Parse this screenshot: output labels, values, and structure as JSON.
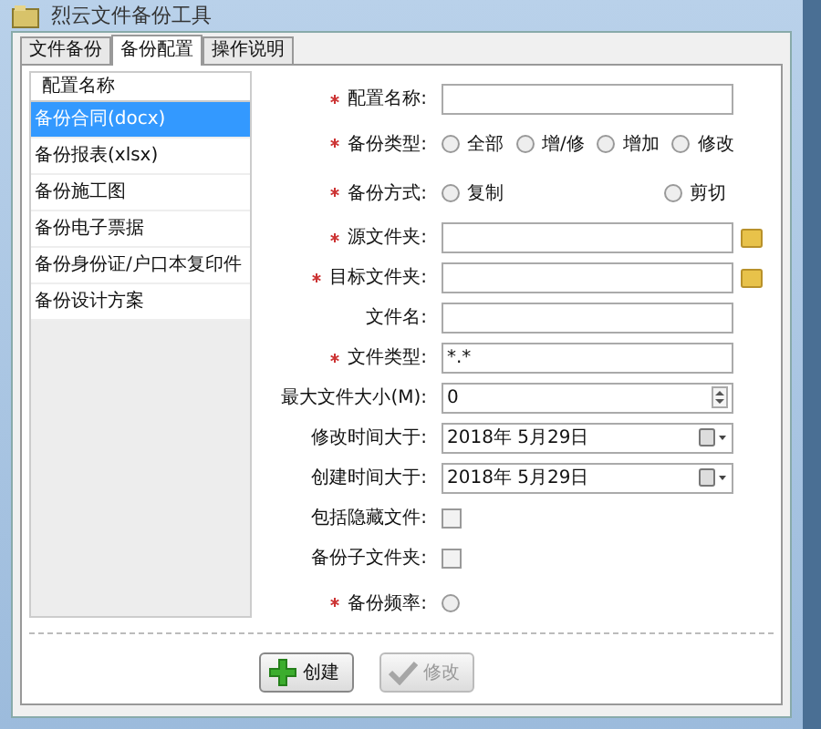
{
  "window": {
    "title": "烈云文件备份工具"
  },
  "tabs": [
    {
      "label": "文件备份",
      "selected": false
    },
    {
      "label": "备份配置",
      "selected": true
    },
    {
      "label": "操作说明",
      "selected": false
    }
  ],
  "config_list": {
    "header": "配置名称",
    "items": [
      {
        "label": "备份合同(docx)",
        "selected": true
      },
      {
        "label": "备份报表(xlsx)",
        "selected": false
      },
      {
        "label": "备份施工图",
        "selected": false
      },
      {
        "label": "备份电子票据",
        "selected": false
      },
      {
        "label": "备份身份证/户口本复印件",
        "selected": false
      },
      {
        "label": "备份设计方案",
        "selected": false
      }
    ]
  },
  "form": [
    {
      "kind": "text",
      "label": "配置名称:",
      "required": true
    },
    {
      "kind": "radio",
      "label": "备份类型:",
      "required": true,
      "options": [
        {
          "label": "全部",
          "selected": false
        },
        {
          "label": "增/修",
          "selected": false
        },
        {
          "label": "增加",
          "selected": false
        },
        {
          "label": "修改",
          "selected": false
        }
      ]
    },
    {
      "kind": "radio2",
      "label": "备份方式:",
      "required": true,
      "options": [
        {
          "label": "复制",
          "selected": false
        },
        {
          "label": "剪切",
          "selected": false
        }
      ]
    },
    {
      "kind": "folder",
      "label": "源文件夹:",
      "required": true
    },
    {
      "kind": "folder",
      "label": "目标文件夹:",
      "required": true
    },
    {
      "kind": "text",
      "label": "文件名:",
      "required": false
    },
    {
      "kind": "text",
      "label": "文件类型:",
      "required": true,
      "value": "*.*"
    },
    {
      "kind": "spin",
      "label": "最大文件大小(M):",
      "required": false,
      "value": "0"
    },
    {
      "kind": "date",
      "label": "修改时间大于:",
      "required": false,
      "value": "2018年  5月29日"
    },
    {
      "kind": "date",
      "label": "创建时间大于:",
      "required": false,
      "value": "2018年  5月29日"
    },
    {
      "kind": "checkbox",
      "label": "包括隐藏文件:",
      "required": false,
      "checked": false
    },
    {
      "kind": "checkbox",
      "label": "备份子文件夹:",
      "required": false,
      "checked": false
    },
    {
      "kind": "radio",
      "label": "备份频率:",
      "required": true,
      "options": [
        {
          "selected": false
        }
      ]
    }
  ],
  "buttons": [
    {
      "kind": "create",
      "label": "创建",
      "disabled": false
    },
    {
      "kind": "edit",
      "label": "修改",
      "disabled": true
    }
  ]
}
